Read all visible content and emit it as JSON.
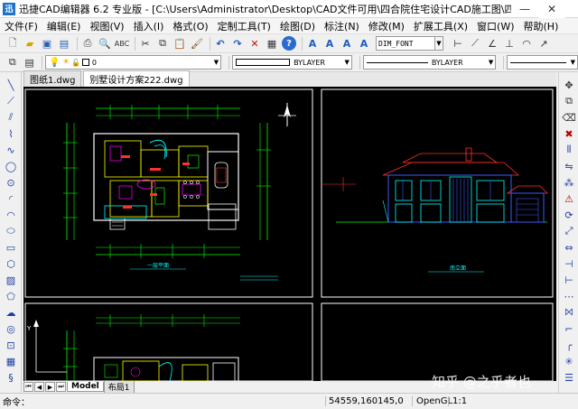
{
  "window": {
    "logo": "迅",
    "title": "迅捷CAD编辑器 6.2 专业版 - [C:\\Users\\Administrator\\Desktop\\CAD文件可用\\四合院住宅设计CAD施工图\\四合院住宅设计CA..."
  },
  "menu": [
    "文件(F)",
    "编辑(E)",
    "视图(V)",
    "插入(I)",
    "格式(O)",
    "定制工具(T)",
    "绘图(D)",
    "标注(N)",
    "修改(M)",
    "扩展工具(X)",
    "窗口(W)",
    "帮助(H)"
  ],
  "toolbar": {
    "dim_font": "DIM_FONT"
  },
  "props": {
    "layer_value": "0",
    "color_value": "BYLAYER",
    "linetype_value": "BYLAYER"
  },
  "doc_tabs": [
    {
      "label": "图纸1.dwg",
      "active": false
    },
    {
      "label": "别墅设计方案222.dwg",
      "active": true
    }
  ],
  "sheet_tabs": [
    {
      "label": "Model",
      "active": true
    },
    {
      "label": "布局1",
      "active": false
    }
  ],
  "drawing_labels": {
    "plan_title": "一层平面",
    "elevation_title": "南立面"
  },
  "status": {
    "command": "命令：",
    "coords": "54559,160145,0",
    "renderer": "OpenGL",
    "scale": "1:1"
  },
  "watermark": "知乎 @之乎者也",
  "colors": {
    "canvas_bg": "#000000",
    "cad_cyan": "#00ffff",
    "cad_yellow": "#ffff00",
    "cad_green": "#00ff00",
    "cad_magenta": "#ff00ff",
    "cad_blue": "#3a5cff",
    "cad_red": "#ff3030"
  }
}
